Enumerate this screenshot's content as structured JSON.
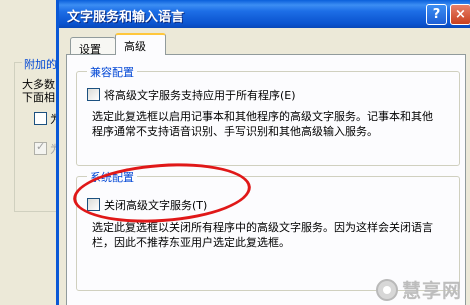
{
  "background_window": {
    "group_title": "附加的",
    "desc_line1": "大多数",
    "desc_line2": "下面相",
    "checkbox1_label": "为",
    "checkbox2_label": "为"
  },
  "dialog": {
    "title": "文字服务和输入语言",
    "help_label": "?",
    "close_label": "×",
    "tabs": [
      {
        "label": "设置",
        "active": false
      },
      {
        "label": "高级",
        "active": true
      }
    ]
  },
  "compat_group": {
    "title": "兼容配置",
    "checkbox_label": "将高级文字服务支持应用于所有程序(E)",
    "checkbox_checked": false,
    "description": "选定此复选框以启用记事本和其他程序的高级文字服务。记事本和其他程序通常不支持语音识别、手写识别和其他高级输入服务。"
  },
  "system_group": {
    "title": "系统配置",
    "checkbox_label": "关闭高级文字服务(T)",
    "checkbox_checked": false,
    "description": "选定此复选框以关闭所有程序中的高级文字服务。因为这样会关闭语言栏，因此不推荐东亚用户选定此复选框。"
  },
  "annotation": {
    "color": "#e01818"
  },
  "watermark": {
    "text": "慧享网"
  }
}
